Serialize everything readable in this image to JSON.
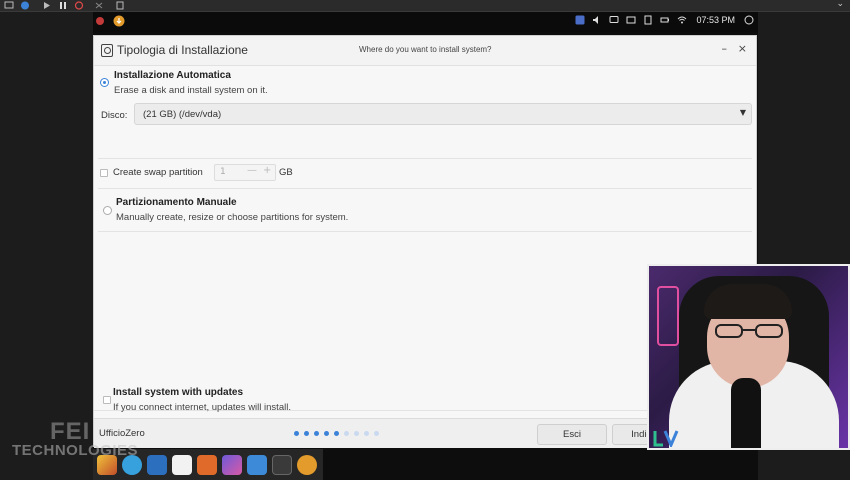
{
  "panel": {
    "clock": "07:53 PM"
  },
  "window": {
    "title": "Tipologia di Installazione",
    "question": "Where do you want to install system?",
    "minimize_glyph": "–",
    "close_glyph": "×"
  },
  "auto_install": {
    "title": "Installazione Automatica",
    "description": "Erase a disk and install system on it.",
    "selected": true
  },
  "disk": {
    "label": "Disco:",
    "value": "(21 GB) (/dev/vda)"
  },
  "swap": {
    "label": "Create swap partition",
    "checked": false,
    "size": "1",
    "minus": "—",
    "plus": "+",
    "unit": "GB"
  },
  "manual": {
    "title": "Partizionamento Manuale",
    "description": "Manually create, resize or choose partitions for system.",
    "selected": false
  },
  "updates": {
    "title": "Install system with updates",
    "description": "If you connect internet, updates will install.",
    "checked": false
  },
  "footer": {
    "brand": "UfficioZero",
    "quit_label": "Esci",
    "back_label": "Indietro",
    "steps_total": 9,
    "steps_done": 5
  },
  "watermark": {
    "line1": "FEI",
    "line2": "TECHNOLOGIES"
  },
  "colors": {
    "accent": "#3b82d8",
    "window_bg": "#f7f7f7",
    "desktop_bg": "#0d0d0d",
    "webcam_bg": "#4b2a6d"
  },
  "icons": {
    "dock": [
      "launcher-icon",
      "browser-icon",
      "security-icon",
      "document-icon",
      "store-icon",
      "photos-icon",
      "files-icon",
      "terminal-icon",
      "installer-icon"
    ]
  }
}
